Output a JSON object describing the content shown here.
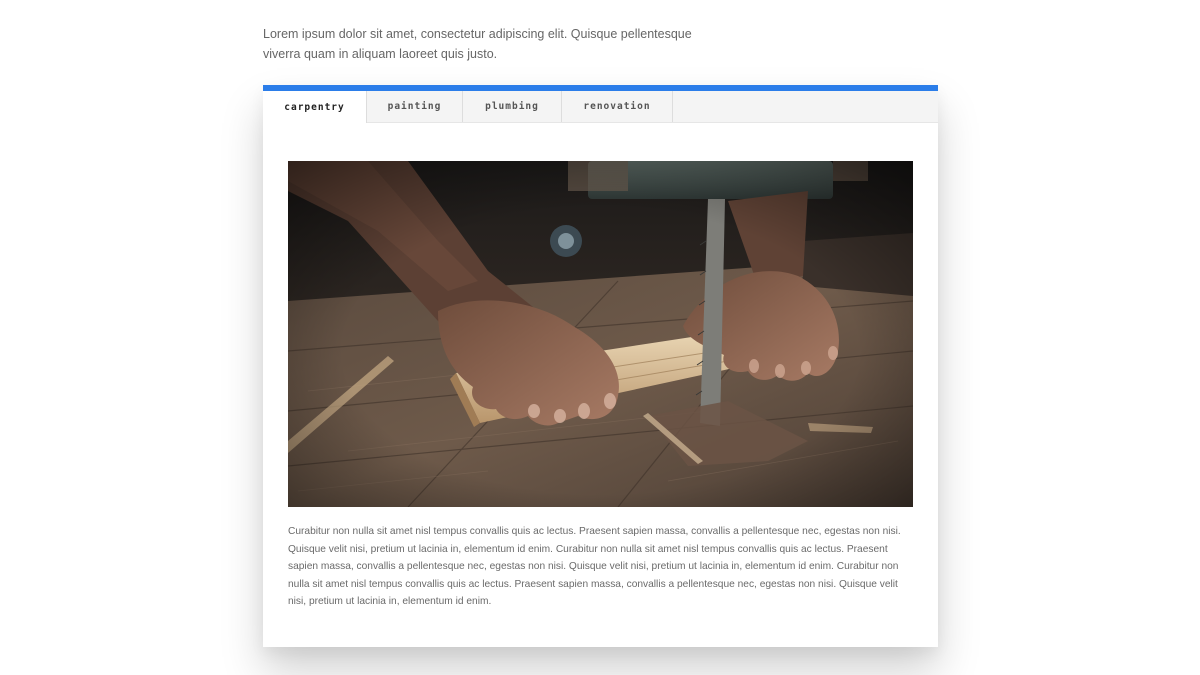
{
  "intro_text": "Lorem ipsum dolor sit amet, consectetur adipiscing elit. Quisque pellentesque viverra quam in aliquam laoreet quis justo.",
  "colors": {
    "accent": "#2b7de9",
    "tab_bar_bg": "#f4f4f4",
    "body_text": "#6a6a6a"
  },
  "tabs": [
    {
      "label": "CARPENTRY",
      "active": true
    },
    {
      "label": "PAINTING",
      "active": false
    },
    {
      "label": "PLUMBING",
      "active": false
    },
    {
      "label": "RENOVATION",
      "active": false
    }
  ],
  "content": {
    "image": "carpenter-sawing-wood-photo",
    "body": "Curabitur non nulla sit amet nisl tempus convallis quis ac lectus. Praesent sapien massa, convallis a pellentesque nec, egestas non nisi. Quisque velit nisi, pretium ut lacinia in, elementum id enim. Curabitur non nulla sit amet nisl tempus convallis quis ac lectus. Praesent sapien massa, convallis a pellentesque nec, egestas non nisi. Quisque velit nisi, pretium ut lacinia in, elementum id enim. Curabitur non nulla sit amet nisl tempus convallis quis ac lectus. Praesent sapien massa, convallis a pellentesque nec, egestas non nisi. Quisque velit nisi, pretium ut lacinia in, elementum id enim."
  }
}
